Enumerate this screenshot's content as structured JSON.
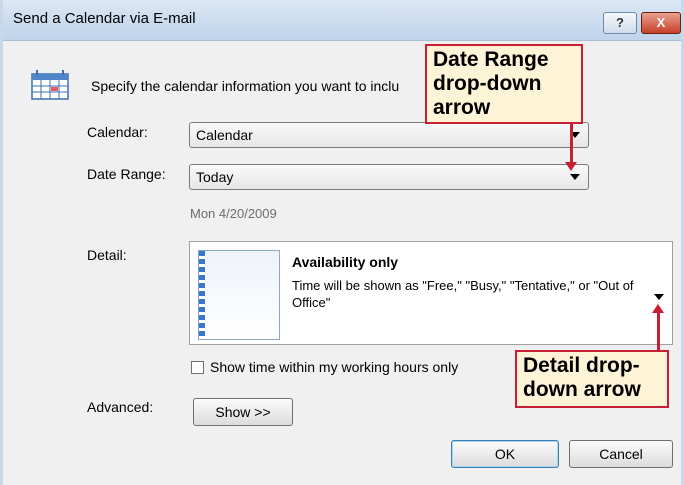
{
  "window": {
    "title": "Send a Calendar via E-mail",
    "help_label": "?",
    "close_label": "X"
  },
  "intro_text": "Specify the calendar information you want to inclu",
  "calendar_field": {
    "label": "Calendar:",
    "value": "Calendar"
  },
  "date_range_field": {
    "label": "Date Range:",
    "value": "Today",
    "date_text": "Mon 4/20/2009"
  },
  "detail": {
    "label": "Detail:",
    "title": "Availability only",
    "description": "Time will be shown as \"Free,\" \"Busy,\" \"Tentative,\" or \"Out of Office\""
  },
  "working_hours_checkbox": {
    "label": "Show time within my working hours only",
    "checked": false
  },
  "advanced": {
    "label": "Advanced:",
    "button_label": "Show >>"
  },
  "buttons": {
    "ok": "OK",
    "cancel": "Cancel"
  },
  "callouts": {
    "date_range": "Date Range drop-down arrow",
    "detail": "Detail drop-down arrow"
  },
  "colors": {
    "callout_border": "#c71f34",
    "callout_fill": "#fdf3d7",
    "titlebar": "#c4d7ec"
  },
  "icons": [
    "calendar-icon",
    "help-icon",
    "close-icon",
    "dropdown-arrow-icon"
  ]
}
